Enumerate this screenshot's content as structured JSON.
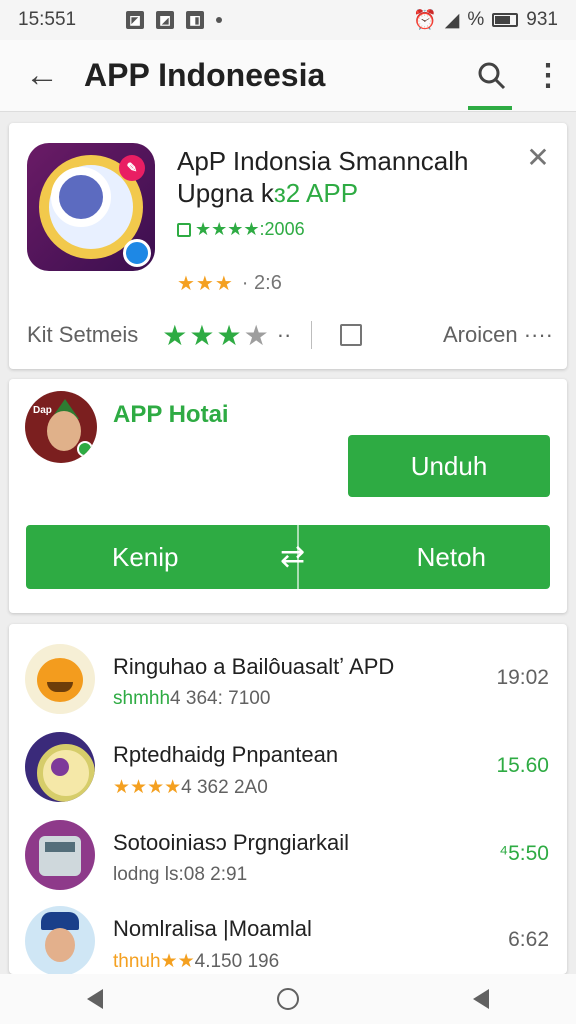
{
  "statusbar": {
    "time": "15:551",
    "right_text": "%",
    "battery_pct": "931",
    "notif_icons": [
      "notification-box-icon",
      "notification-box-icon",
      "notification-box-icon",
      "dot-icon"
    ]
  },
  "appbar": {
    "title": "APP Indoneesia"
  },
  "featured": {
    "title_line1": "ApP Indonsia Smanncalh",
    "title_line2a": "Upgna k",
    "title_line2b": "ɜ2 APP",
    "rating_text": "★★★★:2006",
    "stars": "★★★",
    "rating_value": "· 2:6",
    "row_label": "Kit Setmeis",
    "row_stars": "★★★",
    "row_stars_gray": "★",
    "row_dots": "··",
    "region": "Aroicen ····"
  },
  "promo": {
    "name": "APP Hotai",
    "avatar_label": "Dap",
    "unduh_label": "Unduh",
    "left_label": "Kenip",
    "arrow": "⇄",
    "right_label": "Netoh"
  },
  "list": [
    {
      "name": "Ringuhao a Bailôuasaltʼ APD",
      "meta_prefix": "shmhh",
      "meta_rest": "4 364: 7100",
      "value": "19:02",
      "value_green": false
    },
    {
      "name": "Rptedhaidg Pnpantean",
      "meta_prefix": "★★★★",
      "meta_rest": "4 362 2A0",
      "value": "15.60",
      "value_green": true
    },
    {
      "name": "Sotooiniasɔ Prgngiarkail",
      "meta_prefix": "",
      "meta_rest": "lodng ls:08 2:91",
      "value": "⁴5:50",
      "value_green": true
    },
    {
      "name": "Nomlralisa |Moamlal",
      "meta_prefix": "thnuh★★",
      "meta_rest": "4.150 196",
      "value": "6:62",
      "value_green": false
    }
  ],
  "colors": {
    "accent": "#2eab43",
    "star": "#f4a020"
  }
}
